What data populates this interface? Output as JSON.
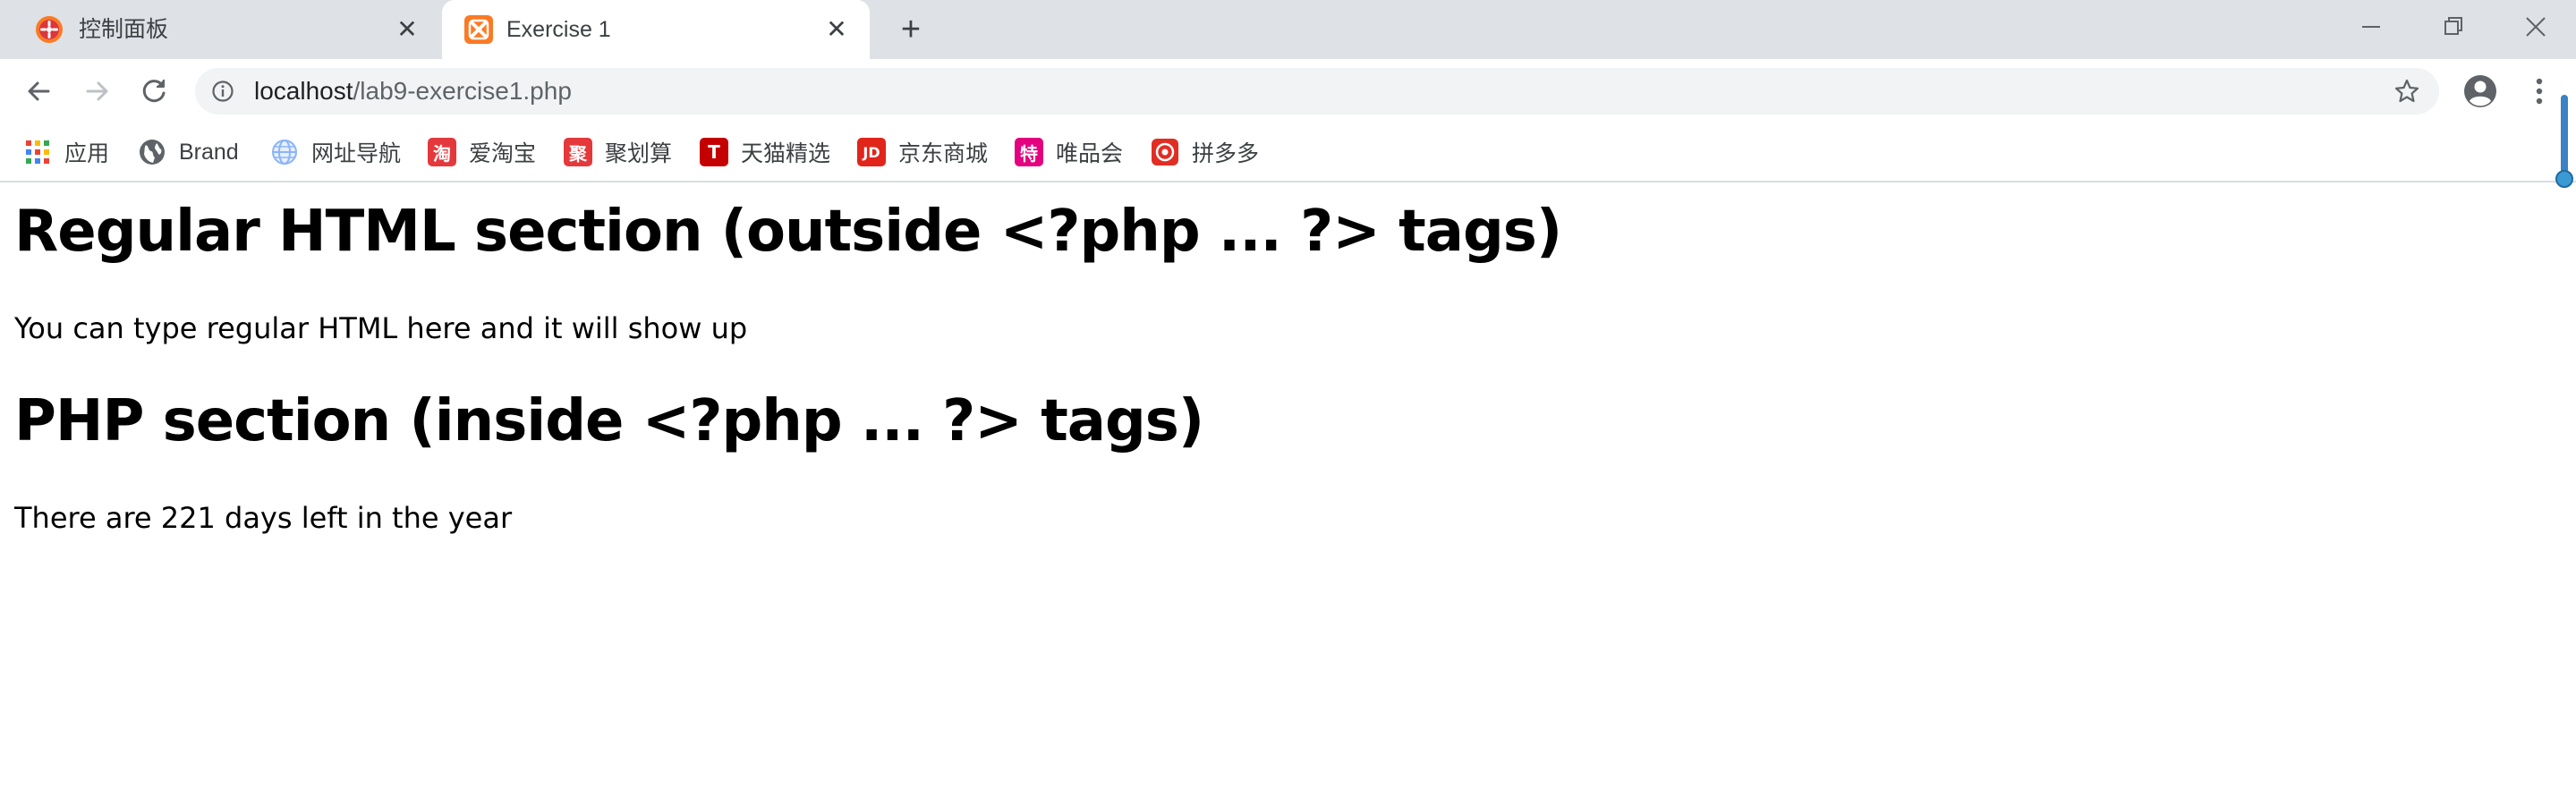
{
  "browser": {
    "tabs": [
      {
        "title": "控制面板",
        "favicon": "xampp-star-icon",
        "active": false
      },
      {
        "title": "Exercise 1",
        "favicon": "xampp-logo-icon",
        "active": true
      }
    ],
    "new_tab_symbol": "+",
    "close_symbol": "✕"
  },
  "toolbar": {
    "url_host": "localhost",
    "url_path": "/lab9-exercise1.php"
  },
  "bookmarks": [
    {
      "label": "应用",
      "icon": "apps-grid-icon",
      "color": "#4285f4",
      "glyph": ""
    },
    {
      "label": "Brand",
      "icon": "globe-dark-icon",
      "color": "#5f6368",
      "glyph": ""
    },
    {
      "label": "网址导航",
      "icon": "globe-blue-icon",
      "color": "#8ab4f8",
      "glyph": ""
    },
    {
      "label": "爱淘宝",
      "icon": "taobao-icon",
      "color": "#e4393c",
      "glyph": "淘"
    },
    {
      "label": "聚划算",
      "icon": "juhuasuan-icon",
      "color": "#e5383b",
      "glyph": "聚"
    },
    {
      "label": "天猫精选",
      "icon": "tmall-icon",
      "color": "#c40000",
      "glyph": "T"
    },
    {
      "label": "京东商城",
      "icon": "jd-icon",
      "color": "#e1251b",
      "glyph": "JD"
    },
    {
      "label": "唯品会",
      "icon": "vip-icon",
      "color": "#e4007f",
      "glyph": "特"
    },
    {
      "label": "拼多多",
      "icon": "pinduoduo-icon",
      "color": "#e02e24",
      "glyph": ""
    }
  ],
  "page": {
    "heading1": "Regular HTML section (outside <?php ... ?> tags)",
    "paragraph1": "You can type regular HTML here and it will show up",
    "heading2": "PHP section (inside <?php ... ?> tags)",
    "paragraph2": "There are 221 days left in the year"
  }
}
